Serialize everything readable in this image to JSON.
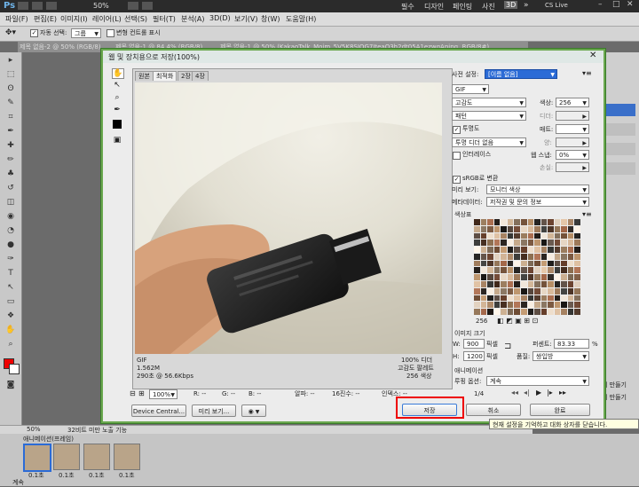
{
  "app": {
    "logo": "Ps",
    "zoom": "50%",
    "workspaces": [
      "필수",
      "디자인",
      "페인팅",
      "사진"
    ],
    "cs_live": "CS Live"
  },
  "menu": [
    "파일(F)",
    "편집(E)",
    "이미지(I)",
    "레이어(L)",
    "선택(S)",
    "필터(T)",
    "분석(A)",
    "3D(D)",
    "보기(V)",
    "창(W)",
    "도움말(H)"
  ],
  "options": {
    "auto_select_label": "자동 선택:",
    "auto_select_value": "그룹",
    "transform_label": "변형 컨트롤 표시"
  },
  "doc_tabs": [
    "제목 없음-2 @ 50% (RGB/8)",
    "제목 없음-1 @ 84.4% (RGB/8)",
    "제목 없음-1 @ 50% (KakaoTalk_Moim_5V5K8SJOG7IteaO3h2dt05A1ezwqApjpg, RGB/8#)"
  ],
  "dialog": {
    "title": "웹 및 장치용으로 저장(100%)",
    "tabs": [
      "원본",
      "최적화",
      "2장",
      "4장"
    ],
    "preset_label": "사전 설정:",
    "preset_value": "[이름 없음]",
    "format": "GIF",
    "reduction": "고감도",
    "colors_label": "색상:",
    "colors_value": "256",
    "dither_method": "패턴",
    "dither_label": "디더:",
    "transparency_label": "투명도",
    "matte_label": "매트:",
    "transparency_dither": "투명 디더 없음",
    "amount_label": "양:",
    "interlaced_label": "인터레이스",
    "websnap_label": "웹 스냅:",
    "websnap_value": "0%",
    "lossy_label": "손실:",
    "srgb_label": "sRGB로 변환",
    "preview_label": "미리 보기:",
    "preview_value": "모니터 색상",
    "metadata_label": "메타데이터:",
    "metadata_value": "저작권 및 문의 정보",
    "color_table_label": "색상표",
    "color_count": "256",
    "image_size_label": "이미지 크기",
    "w_label": "W:",
    "w_value": "900",
    "h_label": "H:",
    "h_value": "1200",
    "px_unit": "픽셀",
    "percent_label": "퍼센트:",
    "percent_value": "83.33",
    "percent_unit": "%",
    "quality_label": "품질:",
    "quality_value": "쌍입방",
    "animation_label": "애니메이션",
    "loop_label": "루핑 옵션:",
    "loop_value": "계속",
    "frame_counter": "1/4",
    "info_left": [
      "GIF",
      "1.562M",
      "290초 @ 56.6Kbps"
    ],
    "info_right": [
      "100% 디더",
      "고감도 팔레트",
      "256 색상"
    ],
    "zoom_value": "100%",
    "readouts": [
      "R: --",
      "G: --",
      "B: --",
      "알파: --",
      "16진수: --",
      "인덱스: --"
    ],
    "device_central": "Device Central...",
    "preview_button": "미리 보기...",
    "save_button": "저장",
    "cancel_button": "취소",
    "done_button": "완료",
    "tooltip": "현재 설정을 기억하고 대화 상자를 닫습니다."
  },
  "status": {
    "zoom": "50%",
    "info": "32비트 미만 노출 기능"
  },
  "animation": {
    "title": "애니메이션(프레임)",
    "loop": "계속",
    "frames": [
      {
        "num": "1",
        "delay": "0.1초"
      },
      {
        "num": "2",
        "delay": "0.1초"
      },
      {
        "num": "3",
        "delay": "0.1초"
      },
      {
        "num": "4",
        "delay": "0.1초"
      }
    ]
  },
  "right_panel": {
    "layer_label": "레이어 0",
    "make_label_1": "기 만들기",
    "make_label_2": "기 만들기"
  },
  "colors": {
    "highlight": "#e00000",
    "dialog_border": "#6aa84f",
    "accent_select": "#2b6bd6"
  }
}
